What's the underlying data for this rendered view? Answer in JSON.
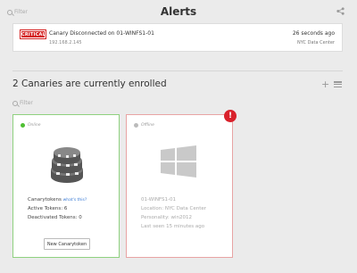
{
  "header": {
    "title": "Alerts",
    "filter_placeholder": "Filter"
  },
  "alert": {
    "badge": "CRITICAL",
    "message": "Canary Disconnected on 01-WINFS1-01",
    "ip": "192.168.2.145",
    "time": "26 seconds ago",
    "location": "NYC Data Center"
  },
  "section": {
    "enrolled_text": "2 Canaries are currently enrolled",
    "filter_placeholder": "Filter"
  },
  "devices": [
    {
      "status": "Online",
      "canarytokens_label": "Canarytokens",
      "whats_this": "what's this?",
      "active_tokens": "Active Tokens: 6",
      "deactivated_tokens": "Deactivated Tokens: 0",
      "new_button": "New Canarytoken"
    },
    {
      "status": "Offline",
      "name": "01-WINFS1-01",
      "location": "Location: NYC Data Center",
      "personality": "Personality: win2012",
      "last_seen": "Last seen 15 minutes ago",
      "badge": "!"
    }
  ],
  "colors": {
    "online": "#4fbf33",
    "offline_border": "#e8a4a4",
    "critical": "#d42020",
    "link": "#3a7bd5"
  }
}
